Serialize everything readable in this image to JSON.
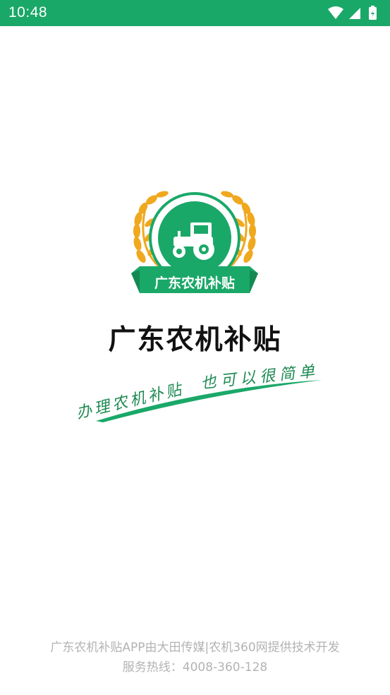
{
  "status_bar": {
    "time": "10:48",
    "icons": [
      "wifi-icon",
      "signal-icon",
      "battery-icon"
    ],
    "background": "#1aa868"
  },
  "logo": {
    "badge_text": "广东农机补贴",
    "primary_color": "#1aa868",
    "wheat_color": "#f0a81e"
  },
  "app_name": "广东农机补贴",
  "slogan": {
    "part1": "办理农机补贴",
    "part2": "也可以很简单"
  },
  "footer": {
    "credit": "广东农机补贴APP由大田传媒|农机360网提供技术开发",
    "hotline": "服务热线：4008-360-128"
  }
}
